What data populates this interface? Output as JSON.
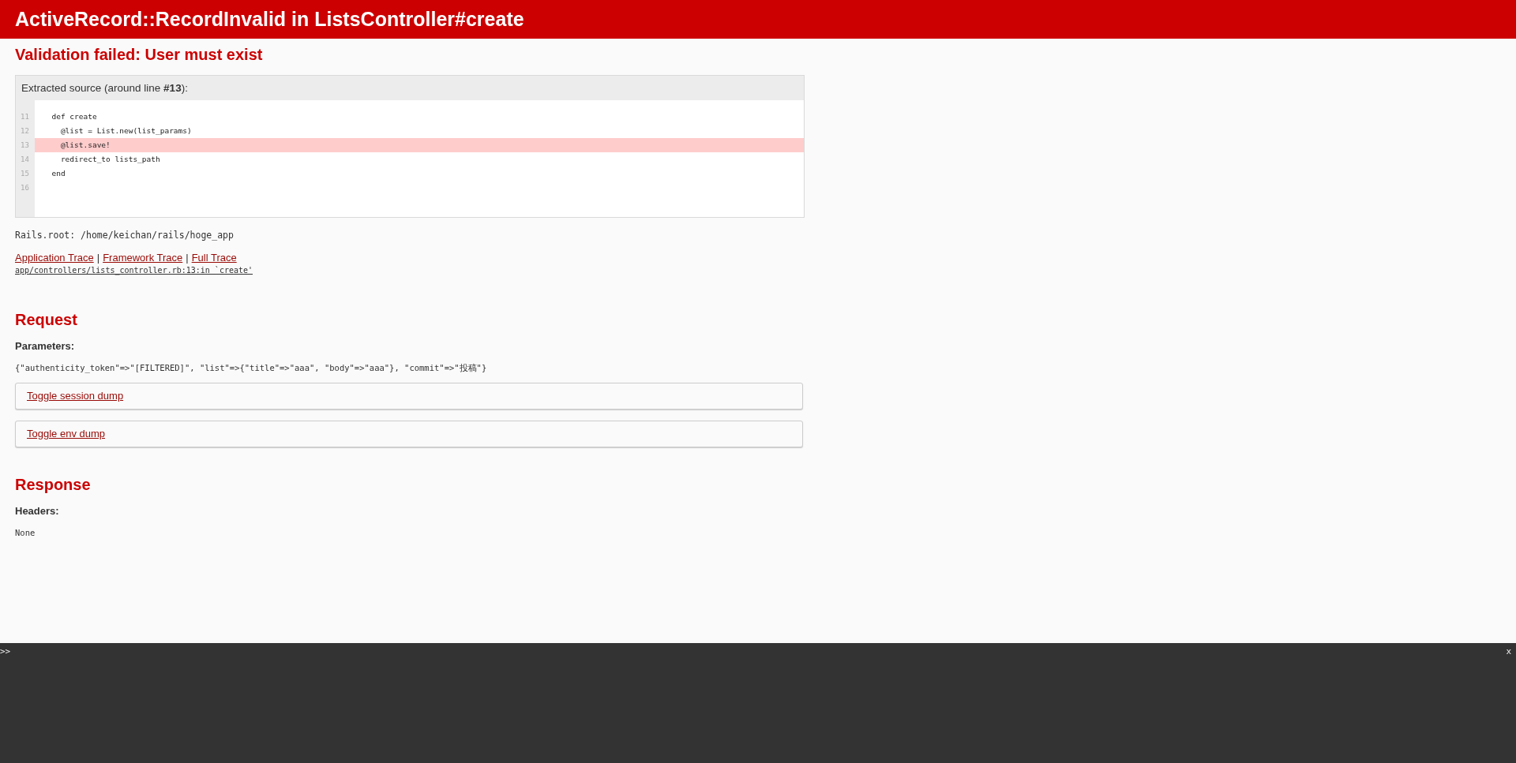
{
  "header": {
    "title": "ActiveRecord::RecordInvalid in ListsController#create"
  },
  "message": "Validation failed: User must exist",
  "source": {
    "caption": "Extracted source (around line **#13**):",
    "lines": [
      {
        "number": "11",
        "code": "  def create",
        "highlighted": false
      },
      {
        "number": "12",
        "code": "    @list = List.new(list_params)",
        "highlighted": false
      },
      {
        "number": "13",
        "code": "    @list.save!",
        "highlighted": true
      },
      {
        "number": "14",
        "code": "    redirect_to lists_path",
        "highlighted": false
      },
      {
        "number": "15",
        "code": "  end",
        "highlighted": false
      },
      {
        "number": "16",
        "highlighted": false
      }
    ]
  },
  "rails_root": "Rails.root: /home/keichan/rails/hoge_app",
  "trace": {
    "links": [
      {
        "label": "Application Trace",
        "separator_after": "|"
      },
      {
        "label": "Framework Trace",
        "separator_after": "|"
      },
      {
        "label": "Full Trace"
      }
    ],
    "entries": [
      "app/controllers/lists_controller.rb:13:in `create'"
    ]
  },
  "request": {
    "heading": "Request",
    "parameters_label": "Parameters:",
    "parameters": "{\"authenticity_token\"=>\"[FILTERED]\", \"list\"=>{\"title\"=>\"aaa\", \"body\"=>\"aaa\"}, \"commit\"=>\"投稿\"}",
    "toggles": [
      "Toggle session dump",
      "Toggle env dump"
    ]
  },
  "response": {
    "heading": "Response",
    "headers_label": "Headers:",
    "headers": "None"
  },
  "console": {
    "prompt": ">>",
    "close": "x"
  }
}
